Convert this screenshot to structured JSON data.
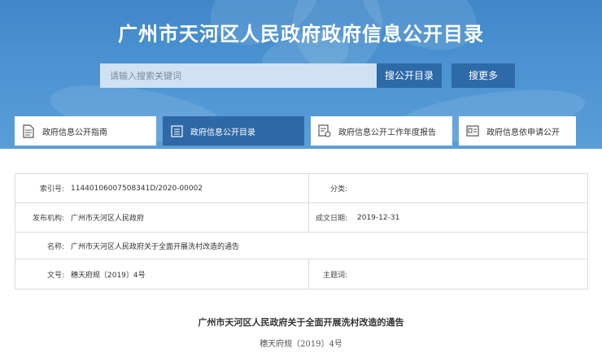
{
  "header": {
    "title": "广州市天河区人民政府政府信息公开目录"
  },
  "search": {
    "placeholder": "请输入搜索关键词",
    "value": "",
    "catalog_button": "搜公开目录",
    "more_button": "搜更多"
  },
  "tabs": [
    {
      "label": "政府信息公开指南",
      "icon": "document-icon",
      "active": false
    },
    {
      "label": "政府信息公开目录",
      "icon": "list-icon",
      "active": true
    },
    {
      "label": "政府信息公开工作年度报告",
      "icon": "report-icon",
      "active": false
    },
    {
      "label": "政府信息依申请公开",
      "icon": "form-icon",
      "active": false
    }
  ],
  "meta": {
    "index_label": "索引号:",
    "index_value": "11440106007508341D/2020-00002",
    "category_label": "分类:",
    "category_value": "",
    "publisher_label": "发布机构:",
    "publisher_value": "广州市天河区人民政府",
    "date_label": "成文日期:",
    "date_value": "2019-12-31",
    "name_label": "名称:",
    "name_value": "广州市天河区人民政府关于全面开展洗村改造的通告",
    "docno_label": "文号:",
    "docno_value": "穗天府规〔2019〕4号",
    "subject_label": "主题词:",
    "subject_value": ""
  },
  "document": {
    "title": "广州市天河区人民政府关于全面开展洗村改造的通告",
    "number": "穗天府规〔2019〕4号"
  },
  "colors": {
    "banner": "#4b93d2",
    "button": "#2c6aa8",
    "active_tab": "#2e68a6",
    "search_bg": "#cfe1f3"
  }
}
